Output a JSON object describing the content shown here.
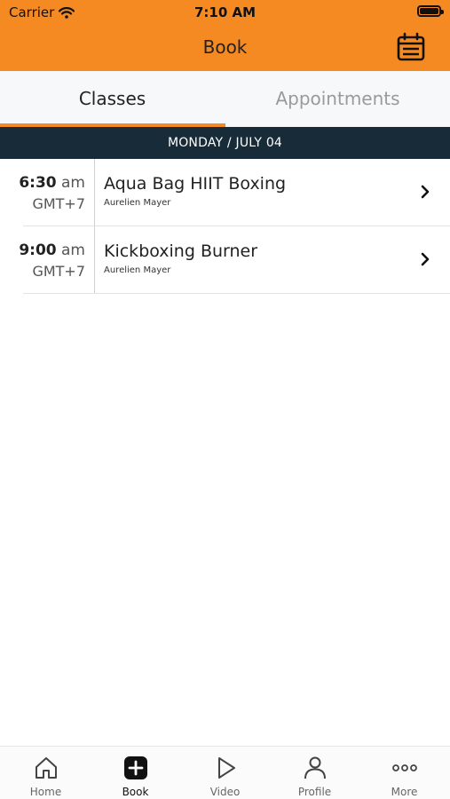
{
  "status_bar": {
    "carrier": "Carrier",
    "time": "7:10 AM"
  },
  "header": {
    "title": "Book",
    "calendar_icon": "calendar-icon",
    "background_color": "#f58a23"
  },
  "tabs": [
    {
      "label": "Classes",
      "active": true
    },
    {
      "label": "Appointments",
      "active": false
    }
  ],
  "date_header": "MONDAY / JULY 04",
  "classes": [
    {
      "time": "6:30",
      "ampm": "am",
      "timezone": "GMT+7",
      "name": "Aqua Bag HIIT Boxing",
      "instructor": "Aurelien Mayer"
    },
    {
      "time": "9:00",
      "ampm": "am",
      "timezone": "GMT+7",
      "name": "Kickboxing Burner",
      "instructor": "Aurelien Mayer"
    }
  ],
  "tab_bar": [
    {
      "label": "Home",
      "icon": "home-icon",
      "active": false
    },
    {
      "label": "Book",
      "icon": "plus-square-icon",
      "active": true
    },
    {
      "label": "Video",
      "icon": "play-icon",
      "active": false
    },
    {
      "label": "Profile",
      "icon": "person-icon",
      "active": false
    },
    {
      "label": "More",
      "icon": "more-dots-icon",
      "active": false
    }
  ],
  "colors": {
    "accent": "#f58a23",
    "date_bar": "#172b38",
    "inactive_tab": "#9a9a9a"
  }
}
